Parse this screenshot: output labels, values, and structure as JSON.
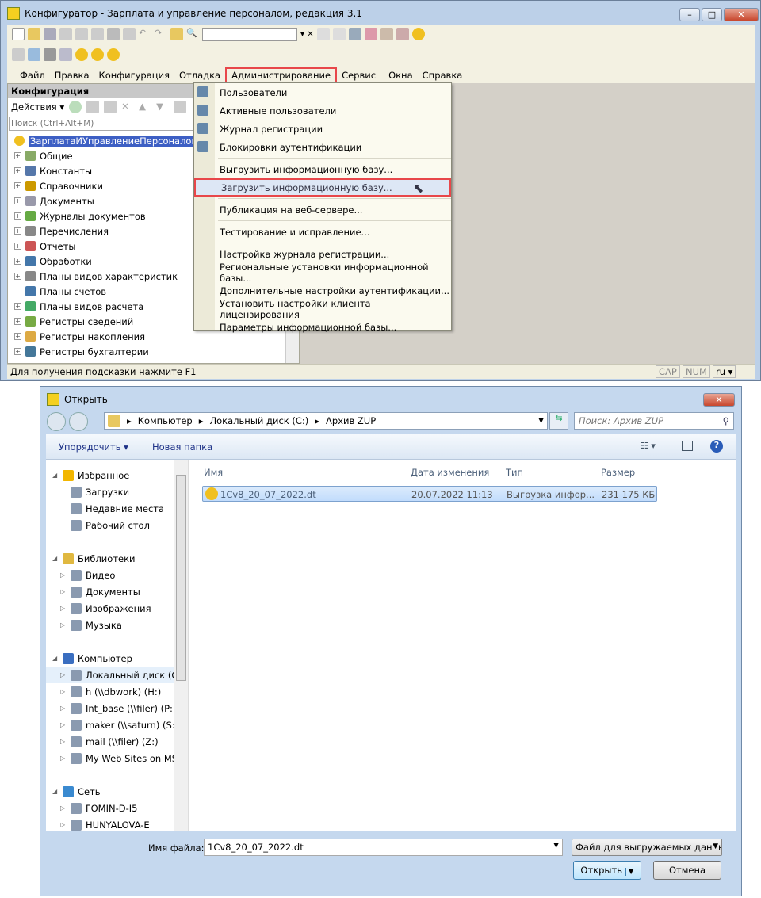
{
  "main": {
    "title": "Конфигуратор - Зарплата и управление персоналом, редакция 3.1",
    "menu": [
      "Файл",
      "Правка",
      "Конфигурация",
      "Отладка",
      "Администрирование",
      "Сервис",
      "Окна",
      "Справка"
    ],
    "panel": {
      "title": "Конфигурация",
      "actions": "Действия",
      "search_placeholder": "Поиск (Ctrl+Alt+M)",
      "tree": [
        "ЗарплатаИУправлениеПерсоналом",
        "Общие",
        "Константы",
        "Справочники",
        "Документы",
        "Журналы документов",
        "Перечисления",
        "Отчеты",
        "Обработки",
        "Планы видов характеристик",
        "Планы счетов",
        "Планы видов расчета",
        "Регистры сведений",
        "Регистры накопления",
        "Регистры бухгалтерии"
      ]
    },
    "admin_menu": [
      [
        "Пользователи",
        "Активные пользователи",
        "Журнал регистрации",
        "Блокировки аутентификации"
      ],
      [
        "Выгрузить информационную базу...",
        "Загрузить информационную базу..."
      ],
      [
        "Публикация на веб-сервере..."
      ],
      [
        "Тестирование и исправление..."
      ],
      [
        "Настройка журнала регистрации...",
        "Региональные установки информационной базы...",
        "Дополнительные настройки аутентификации...",
        "Установить настройки клиента лицензирования",
        "Параметры информационной базы..."
      ]
    ],
    "status": {
      "hint": "Для получения подсказки нажмите F1",
      "cap": "CAP",
      "num": "NUM",
      "lang": "ru"
    },
    "highlight_color": "#e8474a"
  },
  "dialog": {
    "title": "Открыть",
    "path": [
      "Компьютер",
      "Локальный диск (C:)",
      "Архив ZUP"
    ],
    "search_placeholder": "Поиск: Архив ZUP",
    "organize": "Упорядочить",
    "new_folder": "Новая папка",
    "nav": [
      {
        "t": "Избранное",
        "l": 0
      },
      {
        "t": "Загрузки",
        "l": 1
      },
      {
        "t": "Недавние места",
        "l": 1
      },
      {
        "t": "Рабочий стол",
        "l": 1
      },
      {
        "t": "",
        "l": -1
      },
      {
        "t": "Библиотеки",
        "l": 0
      },
      {
        "t": "Видео",
        "l": 1
      },
      {
        "t": "Документы",
        "l": 1
      },
      {
        "t": "Изображения",
        "l": 1
      },
      {
        "t": "Музыка",
        "l": 1
      },
      {
        "t": "",
        "l": -1
      },
      {
        "t": "Компьютер",
        "l": 0
      },
      {
        "t": "Локальный диск (C:)",
        "l": 1
      },
      {
        "t": "h (\\\\dbwork) (H:)",
        "l": 1
      },
      {
        "t": "Int_base (\\\\filer) (P:)",
        "l": 1
      },
      {
        "t": "maker (\\\\saturn) (S:)",
        "l": 1
      },
      {
        "t": "mail (\\\\filer) (Z:)",
        "l": 1
      },
      {
        "t": "My Web Sites on MSN",
        "l": 1
      },
      {
        "t": "",
        "l": -1
      },
      {
        "t": "Сеть",
        "l": 0
      },
      {
        "t": "FOMIN-D-I5",
        "l": 1
      },
      {
        "t": "HUNYALOVA-E",
        "l": 1
      }
    ],
    "columns": [
      "Имя",
      "Дата изменения",
      "Тип",
      "Размер"
    ],
    "files": [
      {
        "name": "1Cv8_20_07_2022.dt",
        "date": "20.07.2022 11:13",
        "type": "Выгрузка инфор...",
        "size": "231 175 КБ"
      }
    ],
    "filename_label": "Имя файла:",
    "filename": "1Cv8_20_07_2022.dt",
    "filter": "Файл для выгружаемых данны",
    "open": "Открыть",
    "cancel": "Отмена"
  }
}
